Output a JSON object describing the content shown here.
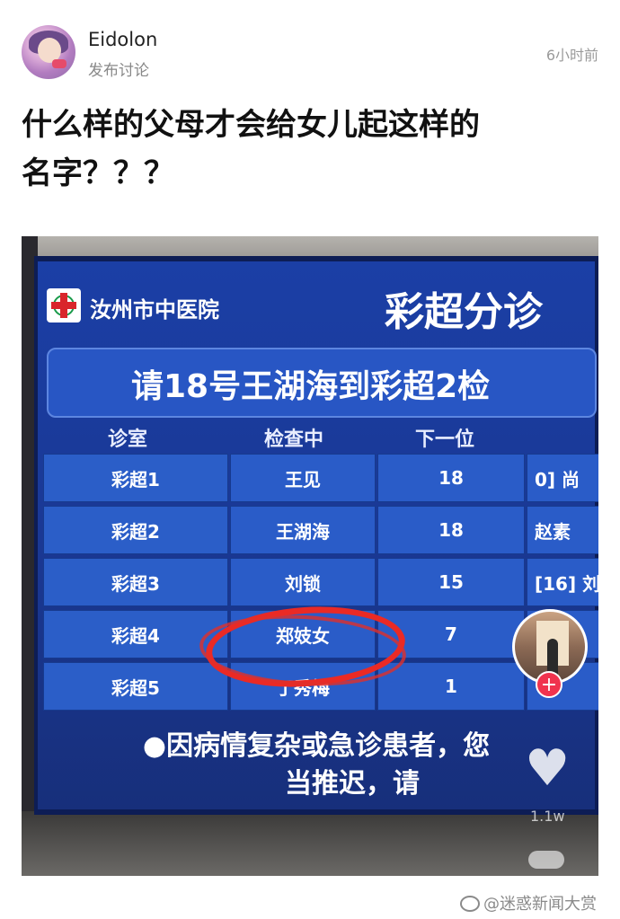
{
  "post": {
    "username": "Eidolon",
    "subtitle": "发布讨论",
    "time": "6小时前",
    "title_line1": "什么样的父母才会给女儿起这样的",
    "title_line2": "名字？？？"
  },
  "screen": {
    "hospital": "汝州市中医院",
    "heading": "彩超分诊",
    "call": "请18号王湖海到彩超2检",
    "headers": [
      "诊室",
      "检查中",
      "下一位"
    ],
    "rows": [
      {
        "room": "彩超1",
        "current": "王见",
        "next": "18",
        "extra": "0] 尚"
      },
      {
        "room": "彩超2",
        "current": "王湖海",
        "next": "18",
        "extra": "赵素"
      },
      {
        "room": "彩超3",
        "current": "刘锁",
        "next": "15",
        "extra": "[16] 刘"
      },
      {
        "room": "彩超4",
        "current": "郑妓女",
        "next": "7",
        "extra": ""
      },
      {
        "room": "彩超5",
        "current": "丁秀梅",
        "next": "1",
        "extra": ""
      }
    ],
    "notice_line1": "●因病情复杂或急诊患者，您",
    "notice_line2": "当推迟，请"
  },
  "overlay": {
    "plus": "+",
    "likes": "1.1w"
  },
  "watermark": "@迷惑新闻大赏",
  "colors": {
    "screen_blue": "#1b3fa6",
    "circle_red": "#ea2a25"
  }
}
